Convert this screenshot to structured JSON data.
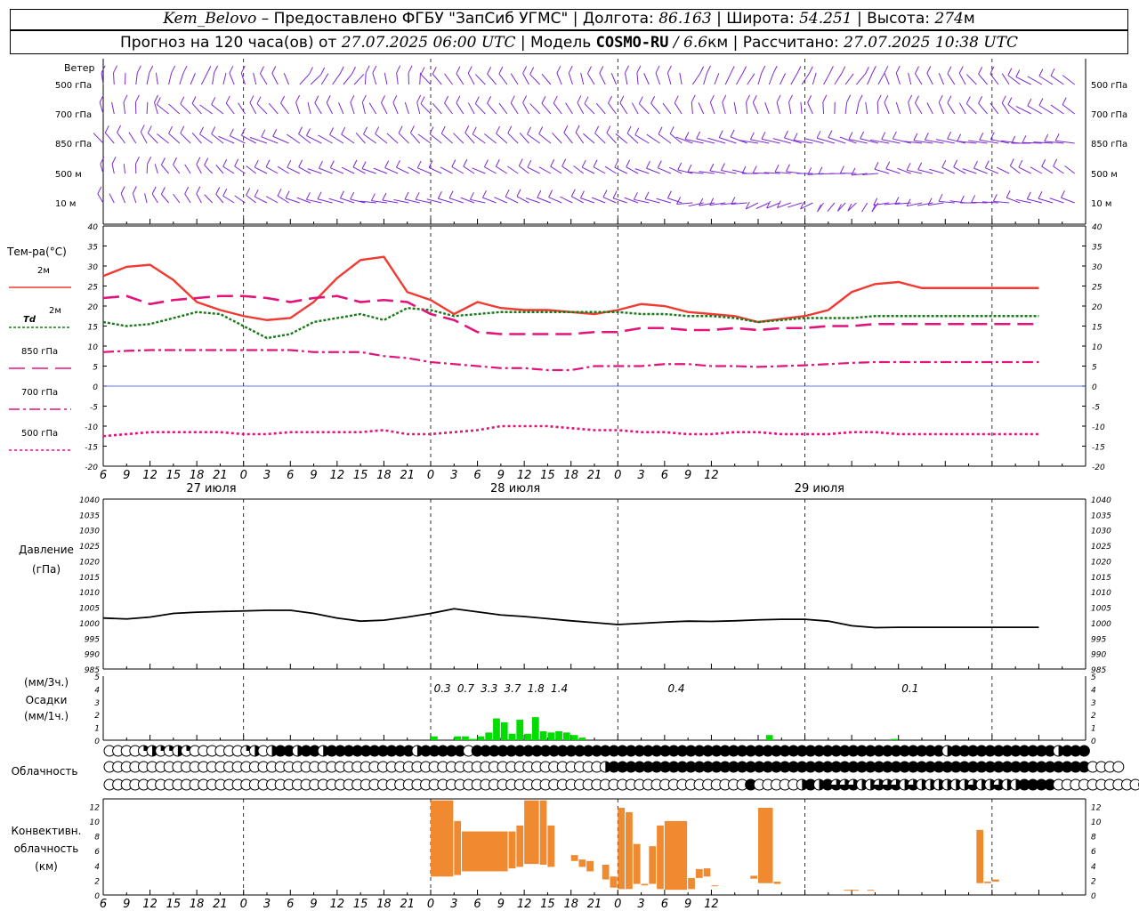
{
  "header": {
    "station": "Kem_Belovo",
    "provider": " – Предоставлено ФГБУ \"ЗапСиб УГМС\" | Долгота: ",
    "lon": "86.163",
    "lat_label": " | Широта: ",
    "lat": "54.251",
    "alt_label": " | Высота: ",
    "alt": "274",
    "alt_unit": "м",
    "forecast_label": "Прогноз на 120 часа(ов) от ",
    "forecast_time": "27.07.2025 06:00 UTC",
    "model_label": " | Модель ",
    "model": "COSMO-RU",
    "model_res": " / 6.6",
    "model_res_unit": "км",
    "calc_label": " | Рассчитано: ",
    "calc_time": "27.07.2025 10:38 UTC"
  },
  "colors": {
    "wind": "#7a2bd0",
    "t2m": "#f03a32",
    "td": "#1a7a1a",
    "t850": "#e0147a",
    "t700": "#e0147a",
    "t500": "#e0147a",
    "zero": "#3344ff",
    "pressure": "#000000",
    "precip": "#00dd00",
    "conv": "#f08a30"
  },
  "axis_labels": {
    "wind": "Ветер",
    "wind_levels": [
      "500 гПа",
      "700 гПа",
      "850 гПа",
      "500 м",
      "10  м"
    ],
    "temp": "Тем-ра(°C)",
    "legend_t2m": "2м",
    "legend_td_a": "Td",
    "legend_td_b": "2м",
    "legend_850": "850 гПа",
    "legend_700": "700 гПа",
    "legend_500": "500 гПа",
    "pressure_a": "Давление",
    "pressure_b": "(гПа)",
    "precip_a": "(мм/3ч.)",
    "precip_b": "Осадки",
    "precip_c": "(мм/1ч.)",
    "cloud": "Облачность",
    "conv_a": "Конвективн.",
    "conv_b": "облачность",
    "conv_c": "(км)"
  },
  "x_ticks": [
    "6",
    "9",
    "12",
    "15",
    "18",
    "21",
    "0",
    "3",
    "6",
    "9",
    "12",
    "15",
    "18",
    "21",
    "0",
    "3",
    "6",
    "9",
    "12",
    "15",
    "18",
    "21",
    "0",
    "3",
    "6",
    "9",
    "12"
  ],
  "dates": [
    "27 июля",
    "28 июля",
    "29 июля"
  ],
  "chart_data": [
    {
      "type": "line",
      "title": "Тем-ра(°C)",
      "x_hours": [
        0,
        3,
        6,
        9,
        12,
        15,
        18,
        21,
        24,
        27,
        30,
        33,
        36,
        39,
        42,
        45,
        48,
        51,
        54,
        57,
        60,
        63,
        66,
        69,
        72,
        75,
        78,
        81,
        84,
        87,
        90,
        93,
        96,
        99,
        102,
        105,
        108,
        111,
        114,
        117,
        120
      ],
      "ylim": [
        -20,
        40
      ],
      "yticks": [
        -20,
        -15,
        -10,
        -5,
        0,
        5,
        10,
        15,
        20,
        25,
        30,
        35,
        40
      ],
      "series": [
        {
          "name": "2м",
          "values": [
            27.5,
            29.8,
            30.3,
            26.5,
            21,
            19,
            17.5,
            16.5,
            17,
            21,
            27,
            31.5,
            32.3,
            23.5,
            21.5,
            18,
            21,
            19.5,
            19,
            19,
            18.5,
            18,
            19,
            20.5,
            20,
            18.5,
            18,
            17.5,
            16,
            16.8,
            17.5,
            19,
            23.5,
            25.5,
            26,
            24.5,
            24.5,
            24.5,
            24.5,
            24.5,
            24.5
          ]
        },
        {
          "name": "Td 2м",
          "values": [
            16,
            15,
            15.5,
            17,
            18.5,
            18,
            15,
            12,
            13,
            16,
            17,
            18,
            16.5,
            19.5,
            19,
            17.5,
            18,
            18.5,
            18.5,
            18.5,
            18.5,
            18.5,
            18.5,
            18,
            18,
            17.5,
            17.5,
            17,
            16,
            16.5,
            17,
            17,
            17,
            17.5,
            17.5,
            17.5,
            17.5,
            17.5,
            17.5,
            17.5,
            17.5
          ]
        },
        {
          "name": "850 гПа",
          "values": [
            22,
            22.5,
            20.5,
            21.5,
            22,
            22.5,
            22.5,
            22,
            21,
            22,
            22.5,
            21,
            21.5,
            21,
            18,
            16.5,
            13.5,
            13,
            13,
            13,
            13,
            13.5,
            13.5,
            14.5,
            14.5,
            14,
            14,
            14.5,
            14,
            14.5,
            14.5,
            15,
            15,
            15.5,
            15.5,
            15.5,
            15.5,
            15.5,
            15.5,
            15.5,
            15.5
          ]
        },
        {
          "name": "700 гПа",
          "values": [
            8.5,
            8.8,
            9,
            9,
            9,
            9,
            9,
            9,
            9,
            8.5,
            8.5,
            8.5,
            7.5,
            7,
            6,
            5.5,
            5,
            4.5,
            4.5,
            4,
            4,
            5,
            5,
            5,
            5.5,
            5.5,
            5,
            5,
            4.8,
            5,
            5.2,
            5.5,
            5.8,
            6,
            6,
            6,
            6,
            6,
            6,
            6,
            6
          ]
        },
        {
          "name": "500 гПа",
          "values": [
            -12.5,
            -12,
            -11.5,
            -11.5,
            -11.5,
            -11.5,
            -12,
            -12,
            -11.5,
            -11.5,
            -11.5,
            -11.5,
            -11,
            -12,
            -12,
            -11.5,
            -11,
            -10,
            -10,
            -10,
            -10.5,
            -11,
            -11,
            -11.5,
            -11.5,
            -12,
            -12,
            -11.5,
            -11.5,
            -12,
            -12,
            -12,
            -11.5,
            -11.5,
            -12,
            -12,
            -12,
            -12,
            -12,
            -12,
            -12
          ]
        }
      ]
    },
    {
      "type": "line",
      "title": "Давление (гПа)",
      "ylim": [
        985,
        1040
      ],
      "yticks": [
        985,
        990,
        995,
        1000,
        1005,
        1010,
        1015,
        1020,
        1025,
        1030,
        1035,
        1040
      ],
      "x_hours": [
        0,
        3,
        6,
        9,
        12,
        15,
        18,
        21,
        24,
        27,
        30,
        33,
        36,
        39,
        42,
        45,
        48,
        51,
        54,
        57,
        60,
        63,
        66,
        69,
        72,
        75,
        78,
        81,
        84,
        87,
        90,
        93,
        96,
        99,
        102,
        105,
        108,
        111,
        114,
        117,
        120
      ],
      "series": [
        {
          "name": "",
          "values": [
            1001.5,
            1001.2,
            1001.8,
            1003,
            1003.4,
            1003.6,
            1003.8,
            1004,
            1004,
            1003,
            1001.5,
            1000.5,
            1000.8,
            1001.8,
            1003,
            1004.5,
            1003.5,
            1002.5,
            1002,
            1001.3,
            1000.6,
            1000,
            999.4,
            999.8,
            1000.2,
            1000.5,
            1000.4,
            1000.6,
            1000.9,
            1001.1,
            1001.1,
            1000.5,
            999,
            998.4,
            998.5,
            998.5,
            998.5,
            998.5,
            998.5,
            998.5,
            998.5
          ]
        }
      ]
    },
    {
      "type": "bar",
      "title": "Осадки (мм/1ч.)",
      "ylim": [
        0,
        5
      ],
      "yticks": [
        0,
        1,
        2,
        3,
        4,
        5
      ],
      "x_hours": [
        42,
        43,
        44,
        45,
        46,
        47,
        48,
        49,
        50,
        51,
        52,
        53,
        54,
        55,
        56,
        57,
        58,
        59,
        60,
        61,
        62,
        63,
        64,
        65,
        66,
        67,
        68,
        69,
        70,
        71,
        72,
        73,
        74,
        75,
        76,
        77,
        78,
        79,
        80,
        81,
        82,
        83,
        84,
        85,
        86,
        87,
        88,
        89,
        90,
        91,
        92,
        93,
        94,
        95,
        96,
        97,
        98,
        99,
        100,
        101,
        102,
        103,
        104,
        105,
        106,
        107,
        108,
        109,
        110,
        111,
        112,
        113,
        114,
        115,
        116,
        117,
        118
      ],
      "values_1h": [
        0.3,
        0,
        0,
        0.3,
        0.3,
        0.1,
        0.3,
        0.6,
        1.7,
        1.4,
        0.5,
        1.6,
        0.5,
        1.8,
        0.7,
        0.6,
        0.7,
        0.6,
        0.4,
        0.2,
        0,
        0,
        0,
        0,
        0,
        0,
        0,
        0,
        0,
        0,
        0,
        0,
        0,
        0,
        0,
        0,
        0,
        0,
        0,
        0,
        0,
        0,
        0,
        0.4,
        0,
        0,
        0,
        0,
        0,
        0,
        0,
        0,
        0,
        0,
        0,
        0,
        0,
        0,
        0,
        0.1,
        0,
        0,
        0,
        0,
        0,
        0,
        0,
        0,
        0,
        0,
        0,
        0,
        0,
        0,
        0,
        0,
        0
      ],
      "labels_3h": [
        "0.3",
        "0.7",
        "3.3",
        "3.7",
        "1.8",
        "1.4",
        "0.4",
        "0.1"
      ],
      "labels_3h_hours": [
        43.5,
        46.5,
        49.5,
        52.5,
        55.5,
        58.5,
        73.5,
        103.5
      ]
    },
    {
      "type": "table",
      "title": "Облачность",
      "rows": 3,
      "note": "per-hour cloud cover symbols, levels high/middle/low; values 0=clear,1=quarter,2=half,3=three-quarter,4=overcast",
      "high": [
        0,
        0,
        0,
        0,
        1,
        2,
        1,
        1,
        2,
        1,
        0,
        0,
        0,
        0,
        0,
        0,
        1,
        2,
        0,
        2,
        4,
        4,
        2,
        4,
        4,
        2,
        4,
        4,
        4,
        4,
        4,
        4,
        4,
        4,
        4,
        4,
        2,
        4,
        4,
        4,
        4,
        4,
        0,
        4,
        4,
        4,
        4,
        4,
        4,
        4,
        4,
        4,
        4,
        4,
        4,
        4,
        4,
        4,
        4,
        4,
        4,
        4,
        4,
        4,
        4,
        4,
        4,
        4,
        4,
        4,
        4,
        4,
        4,
        4,
        4,
        4,
        4,
        4,
        4,
        4,
        4,
        4,
        4,
        4,
        4,
        4,
        4,
        4,
        4,
        4,
        4,
        4,
        4,
        4,
        4,
        4,
        4,
        4,
        2,
        4,
        4,
        4,
        4,
        4,
        4,
        4,
        4,
        4,
        4,
        4,
        4,
        2,
        4,
        4,
        4
      ],
      "mid": [
        0,
        0,
        0,
        0,
        0,
        0,
        0,
        0,
        0,
        0,
        0,
        0,
        0,
        0,
        0,
        0,
        0,
        0,
        0,
        0,
        0,
        0,
        0,
        0,
        0,
        0,
        0,
        0,
        0,
        0,
        0,
        0,
        0,
        0,
        0,
        0,
        0,
        0,
        0,
        0,
        0,
        0,
        0,
        0,
        0,
        0,
        0,
        0,
        0,
        0,
        0,
        0,
        0,
        0,
        0,
        0,
        0,
        0,
        2,
        4,
        4,
        4,
        4,
        4,
        4,
        4,
        4,
        4,
        4,
        4,
        4,
        4,
        4,
        4,
        4,
        4,
        4,
        4,
        4,
        4,
        4,
        4,
        4,
        4,
        4,
        4,
        4,
        4,
        4,
        4,
        4,
        4,
        4,
        4,
        4,
        4,
        4,
        4,
        4,
        4,
        4,
        4,
        4,
        4,
        4,
        4,
        4,
        4,
        4,
        4,
        4,
        4,
        4,
        4,
        4,
        0,
        0,
        0,
        0
      ],
      "low": [
        0,
        0,
        0,
        0,
        0,
        0,
        0,
        0,
        0,
        0,
        0,
        0,
        0,
        0,
        0,
        0,
        0,
        0,
        0,
        0,
        0,
        0,
        0,
        0,
        0,
        0,
        0,
        0,
        0,
        0,
        0,
        0,
        0,
        0,
        0,
        0,
        0,
        0,
        0,
        0,
        0,
        0,
        0,
        0,
        0,
        0,
        0,
        0,
        0,
        0,
        0,
        0,
        0,
        0,
        0,
        0,
        0,
        0,
        0,
        0,
        0,
        0,
        0,
        0,
        0,
        0,
        0,
        0,
        0,
        0,
        0,
        0,
        0,
        0,
        0,
        4,
        0,
        0,
        0,
        0,
        0,
        2,
        4,
        2,
        4,
        3,
        3,
        3,
        2,
        2,
        3,
        3,
        3,
        2,
        3,
        2,
        2,
        2,
        2,
        2,
        2,
        3,
        2,
        2,
        3,
        2,
        2,
        4,
        4,
        4,
        4,
        0,
        0,
        0,
        0,
        0,
        0,
        0,
        0,
        0,
        0,
        0,
        0,
        0,
        0
      ]
    },
    {
      "type": "bar",
      "title": "Конвективн. облачность (км)",
      "ylim": [
        0,
        13
      ],
      "yticks": [
        0,
        2,
        4,
        6,
        8,
        10,
        12
      ],
      "segments": [
        {
          "x0": 42,
          "x1": 45,
          "bottom": 2.5,
          "top": 12.8
        },
        {
          "x0": 45,
          "x1": 46,
          "bottom": 2.7,
          "top": 10
        },
        {
          "x0": 46,
          "x1": 52,
          "bottom": 3.2,
          "top": 8.6
        },
        {
          "x0": 52,
          "x1": 53,
          "bottom": 3.6,
          "top": 8.6
        },
        {
          "x0": 53,
          "x1": 54,
          "bottom": 3.8,
          "top": 9.4
        },
        {
          "x0": 54,
          "x1": 56,
          "bottom": 4.2,
          "top": 12.8
        },
        {
          "x0": 56,
          "x1": 57,
          "bottom": 4.1,
          "top": 12.8
        },
        {
          "x0": 57,
          "x1": 58,
          "bottom": 3.8,
          "top": 9.4
        },
        {
          "x0": 60,
          "x1": 61,
          "bottom": 4.6,
          "top": 5.4
        },
        {
          "x0": 61,
          "x1": 62,
          "bottom": 3.8,
          "top": 4.8
        },
        {
          "x0": 62,
          "x1": 63,
          "bottom": 3.2,
          "top": 4.6
        },
        {
          "x0": 64,
          "x1": 65,
          "bottom": 2.1,
          "top": 4.1
        },
        {
          "x0": 65,
          "x1": 66,
          "bottom": 1,
          "top": 2.5
        },
        {
          "x0": 66,
          "x1": 67,
          "bottom": 0.8,
          "top": 11.8
        },
        {
          "x0": 67,
          "x1": 68,
          "bottom": 0.8,
          "top": 11.2
        },
        {
          "x0": 68,
          "x1": 69,
          "bottom": 1.5,
          "top": 6.9
        },
        {
          "x0": 69,
          "x1": 70,
          "bottom": 1.3,
          "top": 1.5
        },
        {
          "x0": 70,
          "x1": 71,
          "bottom": 1.5,
          "top": 6.6
        },
        {
          "x0": 71,
          "x1": 72,
          "bottom": 0.8,
          "top": 9.4
        },
        {
          "x0": 72,
          "x1": 75,
          "bottom": 0.7,
          "top": 10
        },
        {
          "x0": 75,
          "x1": 76,
          "bottom": 0.8,
          "top": 2.3
        },
        {
          "x0": 76,
          "x1": 77,
          "bottom": 2.3,
          "top": 3.5
        },
        {
          "x0": 77,
          "x1": 78,
          "bottom": 2.5,
          "top": 3.6
        },
        {
          "x0": 78,
          "x1": 79,
          "bottom": 1.2,
          "top": 1.3
        },
        {
          "x0": 83,
          "x1": 84,
          "bottom": 2.2,
          "top": 2.6
        },
        {
          "x0": 84,
          "x1": 86,
          "bottom": 1.6,
          "top": 11.8
        },
        {
          "x0": 86,
          "x1": 87,
          "bottom": 1.5,
          "top": 1.8
        },
        {
          "x0": 95,
          "x1": 97,
          "bottom": 0.6,
          "top": 0.7
        },
        {
          "x0": 98,
          "x1": 99,
          "bottom": 0.6,
          "top": 0.7
        },
        {
          "x0": 112,
          "x1": 113,
          "bottom": 1.6,
          "top": 8.8
        },
        {
          "x0": 113,
          "x1": 114,
          "bottom": 1.6,
          "top": 1.8
        },
        {
          "x0": 114,
          "x1": 115,
          "bottom": 1.8,
          "top": 2.1
        }
      ]
    }
  ]
}
